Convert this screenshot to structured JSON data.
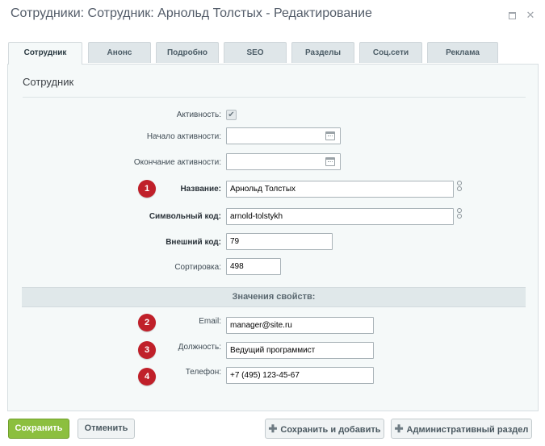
{
  "window": {
    "title": "Сотрудники: Сотрудник: Арнольд Толстых - Редактирование",
    "maximize_icon": "maximize-icon",
    "close_glyph": "✕"
  },
  "tabs": [
    {
      "label": "Сотрудник",
      "active": true
    },
    {
      "label": "Анонс"
    },
    {
      "label": "Подробно"
    },
    {
      "label": "SEO"
    },
    {
      "label": "Разделы"
    },
    {
      "label": "Соц.сети"
    },
    {
      "label": "Реклама"
    }
  ],
  "section": {
    "title": "Сотрудник"
  },
  "fields": {
    "active": {
      "label": "Активность:",
      "checked": true,
      "check_glyph": "✔"
    },
    "active_from": {
      "label": "Начало активности:",
      "value": ""
    },
    "active_to": {
      "label": "Окончание активности:",
      "value": ""
    },
    "name": {
      "label": "Название:",
      "value": "Арнольд Толстых"
    },
    "code": {
      "label": "Символьный код:",
      "value": "arnold-tolstykh"
    },
    "external_code": {
      "label": "Внешний код:",
      "value": "79"
    },
    "sort": {
      "label": "Сортировка:",
      "value": "498"
    }
  },
  "properties": {
    "header": "Значения свойств:",
    "email": {
      "label": "Email:",
      "value": "manager@site.ru"
    },
    "position": {
      "label": "Должность:",
      "value": "Ведущий программист"
    },
    "phone": {
      "label": "Телефон:",
      "value": "+7 (495) 123-45-67"
    }
  },
  "badges": [
    "1",
    "2",
    "3",
    "4"
  ],
  "badge_color": "#c0202a",
  "footer": {
    "save": "Сохранить",
    "cancel": "Отменить",
    "save_add": "Сохранить и добавить",
    "admin": "Административный раздел",
    "plus_glyph": "✚"
  },
  "colors": {
    "save_button": "#8cbf3f",
    "panel_bg": "#f5f9f9"
  }
}
